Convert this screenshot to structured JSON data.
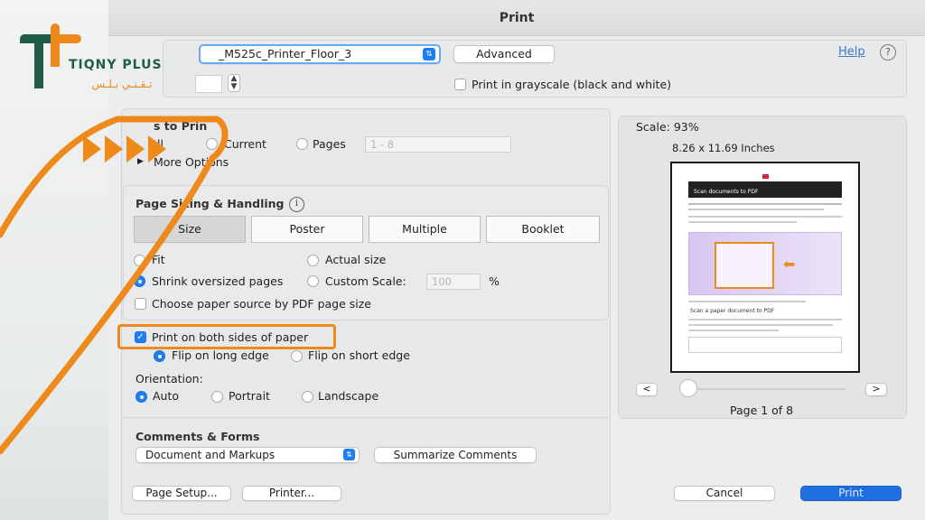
{
  "window": {
    "title": "Print"
  },
  "printer": {
    "name": "_M525c_Printer_Floor_3",
    "advanced_label": "Advanced"
  },
  "help_label": "Help",
  "help_icon": "?",
  "grayscale": {
    "label": "Print in grayscale (black and white)",
    "checked": false
  },
  "pages_to_print": {
    "title_partial": "s to Prin",
    "all_partial": "ll",
    "current": "Current",
    "pages": "Pages",
    "pages_placeholder": "1 - 8",
    "more_options_partial": "More Options"
  },
  "sizing": {
    "title": "Page Sizing & Handling",
    "tabs": [
      "Size",
      "Poster",
      "Multiple",
      "Booklet"
    ],
    "fit": "Fit",
    "actual_size": "Actual size",
    "shrink": "Shrink oversized pages",
    "custom_scale": "Custom Scale:",
    "custom_scale_value": "100",
    "percent": "%",
    "paper_source": "Choose paper source by PDF page size",
    "both_sides": "Print on both sides of paper",
    "flip_long": "Flip on long edge",
    "flip_short": "Flip on short edge",
    "orientation": "Orientation:",
    "auto": "Auto",
    "portrait": "Portrait",
    "landscape": "Landscape"
  },
  "comments": {
    "title": "Comments & Forms",
    "selected": "Document and Markups",
    "summarize": "Summarize Comments"
  },
  "preview": {
    "scale": "Scale:  93%",
    "size": "8.26 x 11.69 Inches",
    "prev": "<",
    "next": ">",
    "page_label": "Page 1 of 8",
    "doc_heading": "Scan documents to PDF",
    "doc_subheading": "Scan a paper document to PDF"
  },
  "footer": {
    "page_setup": "Page Setup...",
    "printer": "Printer...",
    "cancel": "Cancel",
    "print": "Print"
  },
  "logo": {
    "brand": "TIQNY PLUS",
    "arabic": "تـقـنـي  بـلـس"
  },
  "colors": {
    "accent": "#1f7ef4",
    "orange": "#ee8a1c",
    "logo_green": "#1f5c4a"
  }
}
